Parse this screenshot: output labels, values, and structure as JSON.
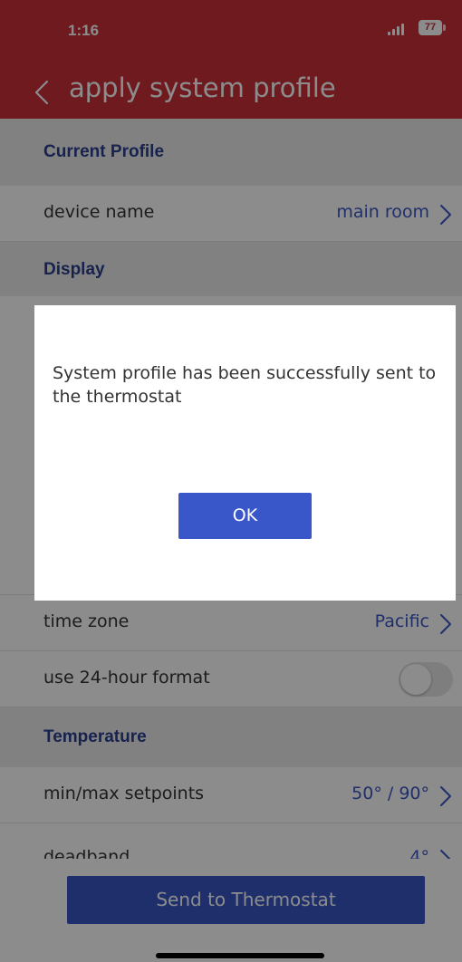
{
  "status_bar": {
    "time": "1:16",
    "battery": "77"
  },
  "header": {
    "title": "apply system profile"
  },
  "sections": {
    "current_profile": "Current Profile",
    "display": "Display",
    "temperature": "Temperature"
  },
  "rows": {
    "device_name": {
      "label": "device name",
      "value": "main room"
    },
    "time_zone": {
      "label": "time zone",
      "value": "Pacific"
    },
    "use_24_hour": {
      "label": "use 24-hour format",
      "enabled": false
    },
    "min_max_setpoints": {
      "label": "min/max setpoints",
      "value": "50° / 90°"
    },
    "deadband": {
      "label": "deadband",
      "value": "4°"
    }
  },
  "send_button": {
    "label": "Send to Thermostat"
  },
  "dialog": {
    "message": "System profile has been successfully sent to the thermostat",
    "ok_label": "OK"
  },
  "colors": {
    "header": "#c8303a",
    "accent": "#3857c5",
    "section_title": "#2b3f8f"
  },
  "icons": [
    "back-chevron-icon",
    "signal-icon",
    "battery-icon",
    "chevron-right-icon"
  ]
}
